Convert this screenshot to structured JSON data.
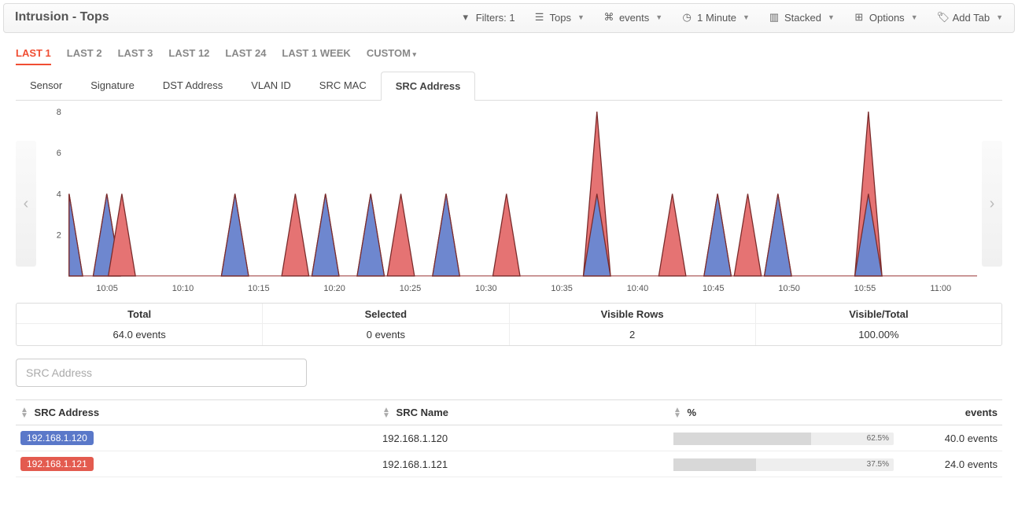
{
  "header": {
    "title": "Intrusion - Tops",
    "tools": {
      "filters": "Filters: 1",
      "tops": "Tops",
      "events": "events",
      "granularity": "1 Minute",
      "stacked": "Stacked",
      "options": "Options",
      "addtab": "Add Tab"
    }
  },
  "time_tabs": {
    "items": [
      "LAST 1",
      "LAST 2",
      "LAST 3",
      "LAST 12",
      "LAST 24",
      "LAST 1 WEEK",
      "CUSTOM"
    ],
    "active": 0
  },
  "sub_tabs": {
    "items": [
      "Sensor",
      "Signature",
      "DST Address",
      "VLAN ID",
      "SRC MAC",
      "SRC Address"
    ],
    "active": 5
  },
  "chart_data": {
    "type": "area",
    "title": "",
    "xlabel": "",
    "ylabel": "",
    "ylim": [
      0,
      8
    ],
    "yticks": [
      2,
      4,
      6,
      8
    ],
    "xticks": [
      "10:05",
      "10:10",
      "10:15",
      "10:20",
      "10:25",
      "10:30",
      "10:35",
      "10:40",
      "10:45",
      "10:50",
      "10:55",
      "11:00"
    ],
    "series": [
      {
        "name": "192.168.1.120",
        "color": "#6E87CF"
      },
      {
        "name": "192.168.1.121",
        "color": "#E57373"
      }
    ],
    "peaks": [
      {
        "x": 0,
        "blue": 4,
        "red": 0,
        "left_cut": true
      },
      {
        "x": 5,
        "blue": 4,
        "red": 0
      },
      {
        "x": 7,
        "blue": 0,
        "red": 4
      },
      {
        "x": 22,
        "blue": 4,
        "red": 0
      },
      {
        "x": 30,
        "blue": 0,
        "red": 4
      },
      {
        "x": 34,
        "blue": 4,
        "red": 0
      },
      {
        "x": 40,
        "blue": 4,
        "red": 0
      },
      {
        "x": 44,
        "blue": 0,
        "red": 4
      },
      {
        "x": 50,
        "blue": 4,
        "red": 0
      },
      {
        "x": 58,
        "blue": 0,
        "red": 4
      },
      {
        "x": 70,
        "blue": 4,
        "red": 4
      },
      {
        "x": 80,
        "blue": 0,
        "red": 4
      },
      {
        "x": 86,
        "blue": 4,
        "red": 0
      },
      {
        "x": 90,
        "blue": 0,
        "red": 4
      },
      {
        "x": 94,
        "blue": 4,
        "red": 0
      },
      {
        "x": 106,
        "blue": 4,
        "red": 4
      },
      {
        "x": 112,
        "blue": 0,
        "red": 0
      }
    ],
    "x_domain": [
      0,
      120
    ]
  },
  "summary": {
    "total": {
      "label": "Total",
      "value": "64.0 events"
    },
    "selected": {
      "label": "Selected",
      "value": "0 events"
    },
    "rows": {
      "label": "Visible Rows",
      "value": "2"
    },
    "ratio": {
      "label": "Visible/Total",
      "value": "100.00%"
    }
  },
  "filter": {
    "placeholder": "SRC Address"
  },
  "table": {
    "headers": {
      "addr": "SRC Address",
      "name": "SRC Name",
      "pct": "%",
      "events": "events"
    },
    "rows": [
      {
        "addr": "192.168.1.120",
        "name": "192.168.1.120",
        "pct": "62.5%",
        "pct_num": 62.5,
        "events": "40.0 events",
        "color": "#5A78C9"
      },
      {
        "addr": "192.168.1.121",
        "name": "192.168.1.121",
        "pct": "37.5%",
        "pct_num": 37.5,
        "events": "24.0 events",
        "color": "#E35B4F"
      }
    ]
  }
}
